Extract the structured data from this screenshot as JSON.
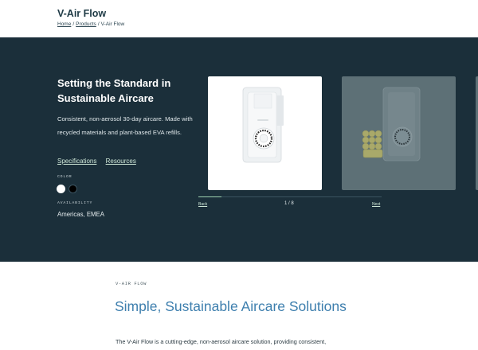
{
  "header": {
    "title": "V-Air Flow",
    "breadcrumb": [
      "Home",
      "Products",
      "V-Air Flow"
    ]
  },
  "hero": {
    "title": "Setting the Standard in Sustainable Aircare",
    "description": "Consistent, non-aerosol 30-day aircare. Made with recycled materials and plant-based EVA refills.",
    "links": [
      "Specifications",
      "Resources"
    ],
    "color_label": "COLOR",
    "colors": [
      "#ffffff",
      "#000000"
    ],
    "availability_label": "AVAILABILITY",
    "availability": "Americas, EMEA"
  },
  "carousel": {
    "back_label": "Back",
    "next_label": "Next",
    "counter": "1 / 8",
    "progress": 0.125
  },
  "section": {
    "eyebrow": "V-AIR FLOW",
    "title": "Simple, Sustainable Aircare Solutions",
    "body": "The V-Air Flow is a cutting-edge, non-aerosol aircare solution, providing consistent,"
  }
}
